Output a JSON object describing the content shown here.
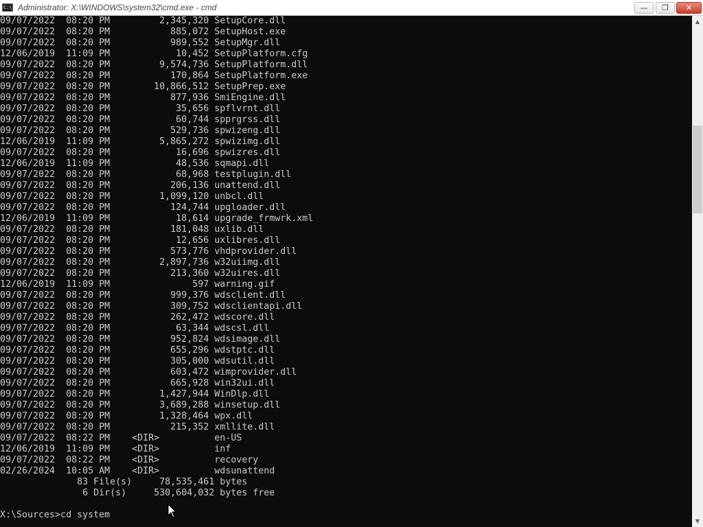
{
  "window": {
    "title": "Administrator: X:\\WINDOWS\\system32\\cmd.exe - cmd",
    "icon_label": "C:\\",
    "controls": {
      "minimize": "—",
      "maximize": "❐",
      "close": "✕"
    }
  },
  "scrollbar": {
    "up_arrow": "▲",
    "down_arrow": "▼"
  },
  "console": {
    "lines": [
      "09/07/2022  08:20 PM         2,345,320 SetupCore.dll",
      "09/07/2022  08:20 PM           885,072 SetupHost.exe",
      "09/07/2022  08:20 PM           989,552 SetupMgr.dll",
      "12/06/2019  11:09 PM            10,452 SetupPlatform.cfg",
      "09/07/2022  08:20 PM         9,574,736 SetupPlatform.dll",
      "09/07/2022  08:20 PM           170,864 SetupPlatform.exe",
      "09/07/2022  08:20 PM        10,866,512 SetupPrep.exe",
      "09/07/2022  08:20 PM           877,936 SmiEngine.dll",
      "09/07/2022  08:20 PM            35,656 spflvrnt.dll",
      "09/07/2022  08:20 PM            60,744 spprgrss.dll",
      "09/07/2022  08:20 PM           529,736 spwizeng.dll",
      "12/06/2019  11:09 PM         5,865,272 spwizimg.dll",
      "09/07/2022  08:20 PM            16,696 spwizres.dll",
      "12/06/2019  11:09 PM            48,536 sqmapi.dll",
      "09/07/2022  08:20 PM            68,968 testplugin.dll",
      "09/07/2022  08:20 PM           206,136 unattend.dll",
      "09/07/2022  08:20 PM         1,099,120 unbcl.dll",
      "09/07/2022  08:20 PM           124,744 upgloader.dll",
      "12/06/2019  11:09 PM            18,614 upgrade_frmwrk.xml",
      "09/07/2022  08:20 PM           181,048 uxlib.dll",
      "09/07/2022  08:20 PM            12,656 uxlibres.dll",
      "09/07/2022  08:20 PM           573,776 vhdprovider.dll",
      "09/07/2022  08:20 PM         2,897,736 w32uiimg.dll",
      "09/07/2022  08:20 PM           213,360 w32uires.dll",
      "12/06/2019  11:09 PM               597 warning.gif",
      "09/07/2022  08:20 PM           999,376 wdsclient.dll",
      "09/07/2022  08:20 PM           309,752 wdsclientapi.dll",
      "09/07/2022  08:20 PM           262,472 wdscore.dll",
      "09/07/2022  08:20 PM            63,344 wdscsl.dll",
      "09/07/2022  08:20 PM           952,824 wdsimage.dll",
      "09/07/2022  08:20 PM           655,296 wdstptc.dll",
      "09/07/2022  08:20 PM           305,000 wdsutil.dll",
      "09/07/2022  08:20 PM           603,472 wimprovider.dll",
      "09/07/2022  08:20 PM           665,928 win32ui.dll",
      "09/07/2022  08:20 PM         1,427,944 WinDlp.dll",
      "09/07/2022  08:20 PM         3,689,288 winsetup.dll",
      "09/07/2022  08:20 PM         1,328,464 wpx.dll",
      "09/07/2022  08:20 PM           215,352 xmllite.dll",
      "09/07/2022  08:22 PM    <DIR>          en-US",
      "12/06/2019  11:09 PM    <DIR>          inf",
      "09/07/2022  08:22 PM    <DIR>          recovery",
      "02/26/2024  10:05 AM    <DIR>          wdsunattend",
      "              83 File(s)     78,535,461 bytes",
      "               6 Dir(s)     530,604,032 bytes free",
      "",
      "X:\\Sources>cd system"
    ]
  }
}
